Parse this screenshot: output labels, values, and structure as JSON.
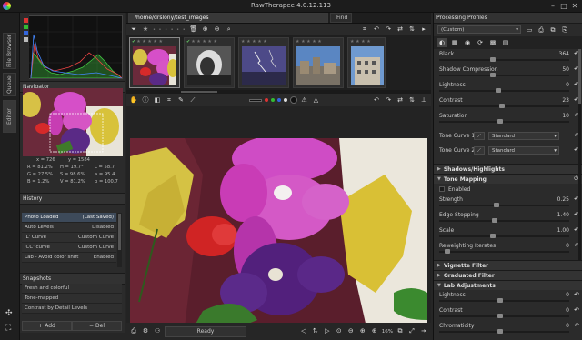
{
  "window": {
    "title": "RawTherapee 4.0.12.113",
    "minimize": "–",
    "maximize": "□",
    "close": "✕"
  },
  "left_tabs": [
    "File Browser",
    "Queue",
    "Editor"
  ],
  "navigator": {
    "title": "Navigator",
    "coords": {
      "x": "x = 726",
      "y": "y = 1584"
    },
    "values": [
      [
        "R = 81.2%",
        "H = 19.7°",
        "L = 58.7"
      ],
      [
        "G = 27.5%",
        "S = 98.6%",
        "a = 95.4"
      ],
      [
        "B = 1.2%",
        "V = 81.2%",
        "b = 100.7"
      ]
    ]
  },
  "history": {
    "title": "History",
    "rows": [
      {
        "label": "Photo Loaded",
        "value": "(Last Saved)",
        "selected": true
      },
      {
        "label": "Auto Levels",
        "value": "Disabled"
      },
      {
        "label": "'L' Curve",
        "value": "Custom Curve"
      },
      {
        "label": "'CC' curve",
        "value": "Custom Curve"
      },
      {
        "label": "Lab - Avoid color shift",
        "value": "Enabled"
      }
    ]
  },
  "snapshots": {
    "title": "Snapshots",
    "rows": [
      "Fresh and colorful",
      "Tone-mapped",
      "Contrast by Detail Levels"
    ],
    "add": "Add",
    "del": "Del"
  },
  "browser": {
    "path": "/home/drslony/test_images",
    "find_tab": "Find",
    "thumbs": [
      {
        "name": "flower",
        "selected": true,
        "checked": true
      },
      {
        "name": "bw",
        "checked": true
      },
      {
        "name": "lightning"
      },
      {
        "name": "town"
      },
      {
        "name": "building"
      }
    ]
  },
  "editor": {
    "status": "Ready",
    "zoom": "16%"
  },
  "right": {
    "profiles": {
      "title": "Processing Profiles",
      "value": "(Custom)"
    },
    "exposure": [
      {
        "label": "Black",
        "value": "364"
      },
      {
        "label": "Shadow Compression",
        "value": "50"
      },
      {
        "label": "Lightness",
        "value": "0"
      },
      {
        "label": "Contrast",
        "value": "23"
      },
      {
        "label": "Saturation",
        "value": "10"
      }
    ],
    "tone_curve_1": {
      "label": "Tone Curve 1",
      "mode": "Standard"
    },
    "tone_curve_2": {
      "label": "Tone Curve 2",
      "mode": "Standard"
    },
    "sections": {
      "shadows": "Shadows/Highlights",
      "tonemap": "Tone Mapping",
      "tonemap_enabled": "Enabled",
      "vignette": "Vignette Filter",
      "graduated": "Graduated Filter",
      "lab": "Lab Adjustments"
    },
    "tonemap": [
      {
        "label": "Strength",
        "value": "0.25"
      },
      {
        "label": "Edge Stopping",
        "value": "1.40"
      },
      {
        "label": "Scale",
        "value": "1.00"
      },
      {
        "label": "Reweighting Iterates",
        "value": "0"
      }
    ],
    "lab": [
      {
        "label": "Lightness",
        "value": "0"
      },
      {
        "label": "Contrast",
        "value": "0"
      },
      {
        "label": "Chromaticity",
        "value": "0"
      }
    ]
  },
  "colors": {
    "accent": "#3d4a5a",
    "bg": "#2b2b2b"
  }
}
